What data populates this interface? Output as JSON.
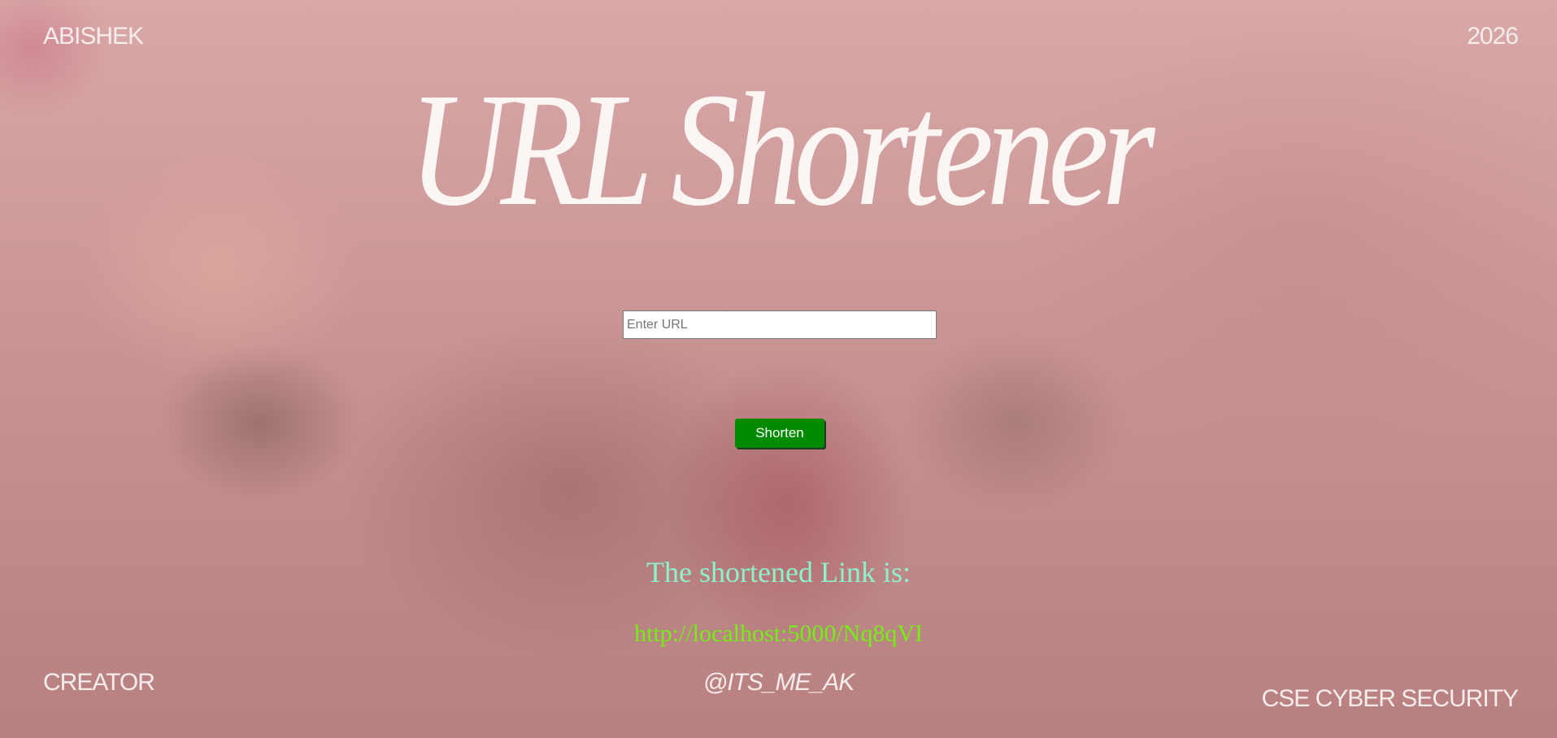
{
  "header": {
    "left_label": "ABISHEK",
    "right_label": "2026"
  },
  "title": "URL Shortener",
  "form": {
    "url_placeholder": "Enter URL",
    "url_value": "",
    "submit_label": "Shorten"
  },
  "result": {
    "heading": "The shortened Link is:",
    "link": "http://localhost:5000/Nq8qVI"
  },
  "footer": {
    "left_label": "CREATOR",
    "handle": "@ITS_ME_AK",
    "right_label": "CSE CYBER SECURITY"
  },
  "colors": {
    "button_bg": "#008a00",
    "heading_text": "#8ff0cc",
    "link_text": "#74ee15",
    "title_text": "#fbf6f3"
  }
}
